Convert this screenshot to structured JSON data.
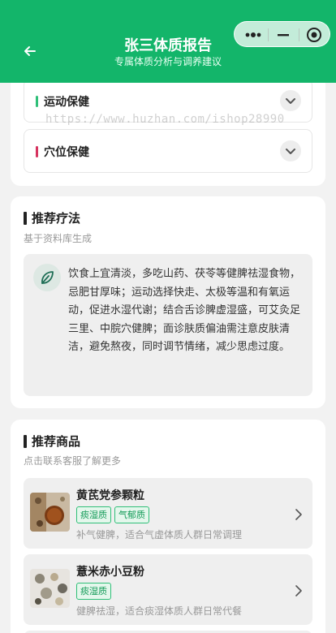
{
  "header": {
    "title": "张三体质报告",
    "subtitle": "专属体质分析与调养建议",
    "accent_color": "#13b56a"
  },
  "health_sections": [
    {
      "label": "运动保健",
      "color": "#2fbf78"
    },
    {
      "label": "穴位保健",
      "color": "#d6335f"
    }
  ],
  "watermark": "https://www.huzhan.com/ishop28990",
  "therapy": {
    "title": "推荐疗法",
    "subtitle": "基于资料库生成",
    "text": "饮食上宜清淡，多吃山药、茯苓等健脾祛湿食物，忌肥甘厚味；运动选择快走、太极等温和有氧运动，促进水湿代谢；结合舌诊脾虚湿盛，可艾灸足三里、中脘穴健脾；面诊肤质偏油需注意皮肤清洁，避免熬夜，同时调节情绪，减少思虑过度。"
  },
  "products": {
    "title": "推荐商品",
    "subtitle": "点击联系客服了解更多",
    "items": [
      {
        "name": "黄芪党参颗粒",
        "tags": [
          "痰湿质",
          "气郁质"
        ],
        "desc": "补气健脾，适合气虚体质人群日常调理"
      },
      {
        "name": "薏米赤小豆粉",
        "tags": [
          "痰湿质"
        ],
        "desc": "健脾祛湿，适合痰湿体质人群日常代餐"
      }
    ]
  }
}
